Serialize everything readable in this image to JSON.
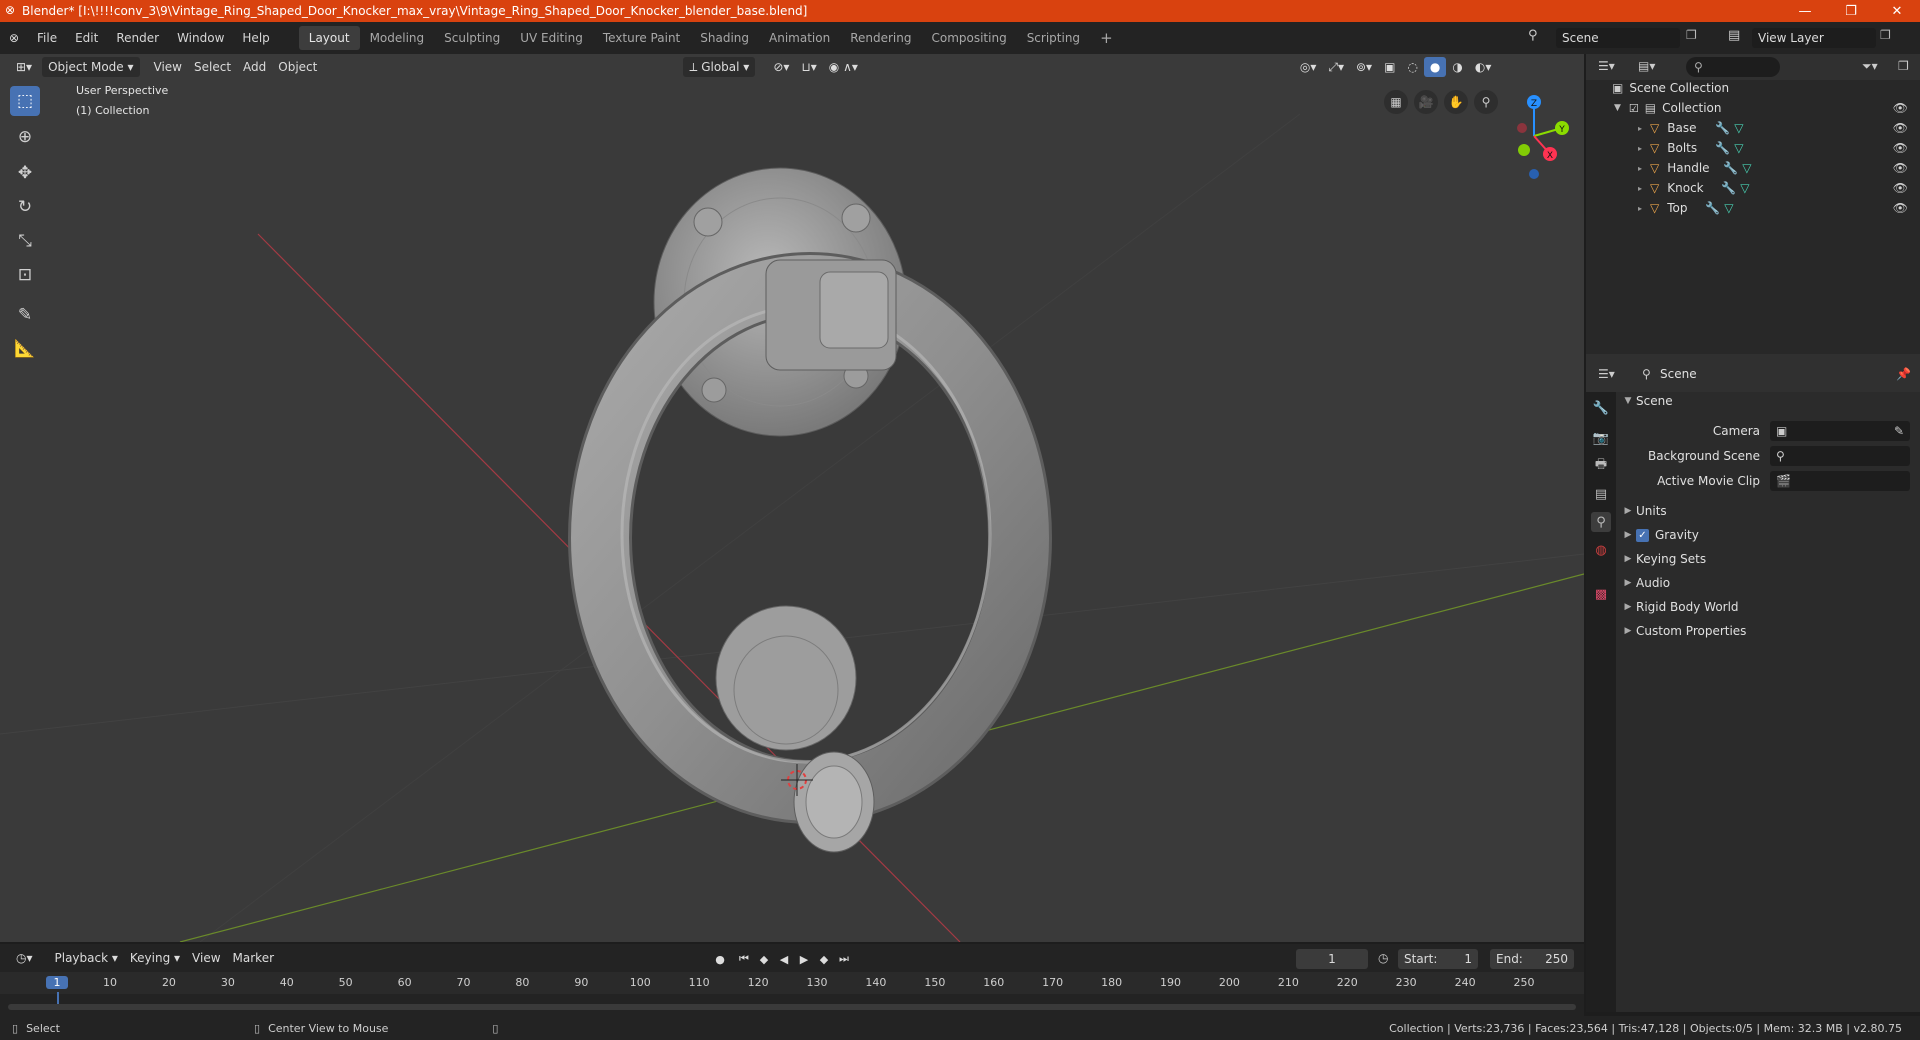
{
  "titlebar": {
    "title": "Blender* [I:\\!!!!conv_3\\9\\Vintage_Ring_Shaped_Door_Knocker_max_vray\\Vintage_Ring_Shaped_Door_Knocker_blender_base.blend]",
    "minimize": "—",
    "maximize": "❐",
    "close": "✕"
  },
  "menu": [
    "File",
    "Edit",
    "Render",
    "Window",
    "Help"
  ],
  "workspaces": [
    "Layout",
    "Modeling",
    "Sculpting",
    "UV Editing",
    "Texture Paint",
    "Shading",
    "Animation",
    "Rendering",
    "Compositing",
    "Scripting"
  ],
  "workspace_add": "+",
  "scene_field": "Scene",
  "view_layer_field": "View Layer",
  "viewport": {
    "mode": "Object Mode",
    "menus": [
      "View",
      "Select",
      "Add",
      "Object"
    ],
    "transform_orientation": "Global",
    "overlay_text": [
      "User Perspective",
      "(1) Collection"
    ],
    "gizmo_axes": [
      "Z",
      "Y",
      "X"
    ]
  },
  "outliner": {
    "root": "Scene Collection",
    "collection": "Collection",
    "objects": [
      "Base",
      "Bolts",
      "Handle",
      "Knock",
      "Top"
    ]
  },
  "properties": {
    "header": "Scene",
    "panel": "Scene",
    "fields": [
      "Camera",
      "Background Scene",
      "Active Movie Clip"
    ],
    "sections": [
      "Units",
      "Gravity",
      "Keying Sets",
      "Audio",
      "Rigid Body World",
      "Custom Properties"
    ],
    "gravity_checked": true
  },
  "timeline": {
    "menus": [
      "Playback",
      "Keying",
      "View",
      "Marker"
    ],
    "current_frame": "1",
    "start_label": "Start:",
    "start": "1",
    "end_label": "End:",
    "end": "250",
    "ticks": [
      "1",
      "10",
      "20",
      "30",
      "40",
      "50",
      "60",
      "70",
      "80",
      "90",
      "100",
      "110",
      "120",
      "130",
      "140",
      "150",
      "160",
      "170",
      "180",
      "190",
      "200",
      "210",
      "220",
      "230",
      "240",
      "250"
    ]
  },
  "status": {
    "left1": "Select",
    "left2": "Center View to Mouse",
    "right": "Collection | Verts:23,736 | Faces:23,564 | Tris:47,128 | Objects:0/5 | Mem: 32.3 MB | v2.80.75"
  },
  "colors": {
    "title_accent": "#d9420f",
    "active_tool": "#4772b3",
    "x_axis": "#ff3352",
    "y_axis": "#8bdc00",
    "z_axis": "#2890ff"
  }
}
